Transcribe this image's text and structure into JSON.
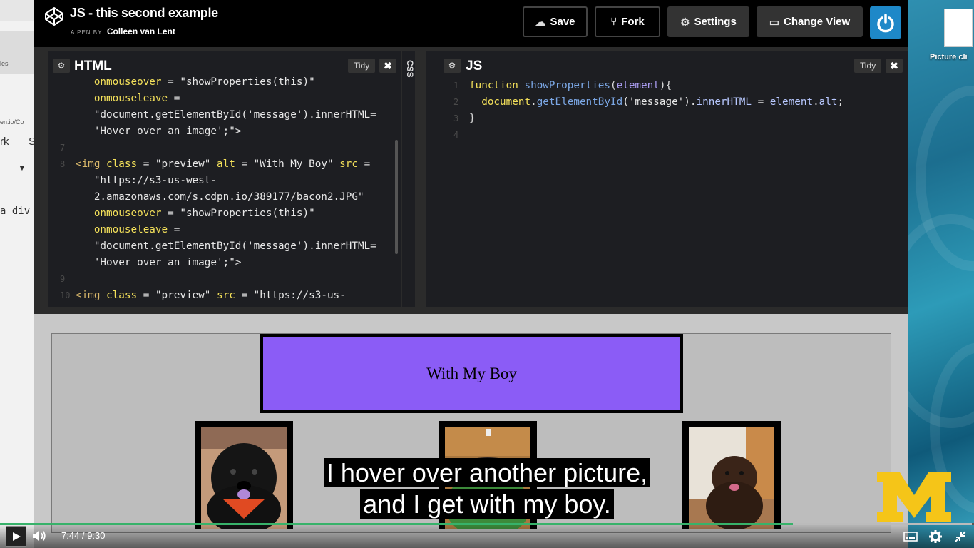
{
  "left_browser": {
    "fragments": [
      "les",
      "en.io/Co",
      "rk",
      "S",
      "▼",
      "a div"
    ]
  },
  "desktop": {
    "file_label": "Picture cli"
  },
  "header": {
    "logo_icon": "codepen-logo-icon",
    "title": "JS - this second example",
    "pen_by_tag": "A PEN BY",
    "author": "Colleen van Lent",
    "buttons": {
      "save": "Save",
      "fork": "Fork",
      "settings": "Settings",
      "change_view": "Change View"
    },
    "power_icon": "power-icon",
    "brand_color": "#1e88c8"
  },
  "html_pane": {
    "title": "HTML",
    "tidy": "Tidy",
    "close": "✖",
    "css_collapsed_label": "CSS",
    "lines": [
      {
        "n": "",
        "segments": [
          {
            "t": "   ",
            "c": ""
          },
          {
            "t": "onmouseover",
            "c": "attr"
          },
          {
            "t": " = ",
            "c": ""
          },
          {
            "t": "\"showProperties(this)\"",
            "c": "str"
          }
        ]
      },
      {
        "n": "",
        "segments": [
          {
            "t": "   ",
            "c": ""
          },
          {
            "t": "onmouseleave",
            "c": "attr"
          },
          {
            "t": " =",
            "c": ""
          }
        ]
      },
      {
        "n": "",
        "segments": [
          {
            "t": "   ",
            "c": ""
          },
          {
            "t": "\"document.getElementById('message').innerHTML=",
            "c": "str"
          }
        ]
      },
      {
        "n": "",
        "segments": [
          {
            "t": "   ",
            "c": ""
          },
          {
            "t": "'Hover over an image';\">",
            "c": "str"
          }
        ]
      },
      {
        "n": "7",
        "segments": []
      },
      {
        "n": "8",
        "segments": [
          {
            "t": "<img ",
            "c": "tag"
          },
          {
            "t": "class",
            "c": "attr"
          },
          {
            "t": " = ",
            "c": ""
          },
          {
            "t": "\"preview\"",
            "c": "str"
          },
          {
            "t": " ",
            "c": ""
          },
          {
            "t": "alt",
            "c": "attr"
          },
          {
            "t": " = ",
            "c": ""
          },
          {
            "t": "\"With My Boy\"",
            "c": "str"
          },
          {
            "t": " ",
            "c": ""
          },
          {
            "t": "src",
            "c": "attr"
          },
          {
            "t": " =",
            "c": ""
          }
        ]
      },
      {
        "n": "",
        "segments": [
          {
            "t": "   ",
            "c": ""
          },
          {
            "t": "\"https://s3-us-west-",
            "c": "str"
          }
        ]
      },
      {
        "n": "",
        "segments": [
          {
            "t": "   ",
            "c": ""
          },
          {
            "t": "2.amazonaws.com/s.cdpn.io/389177/bacon2.JPG\"",
            "c": "str"
          }
        ]
      },
      {
        "n": "",
        "segments": [
          {
            "t": "   ",
            "c": ""
          },
          {
            "t": "onmouseover",
            "c": "attr"
          },
          {
            "t": " = ",
            "c": ""
          },
          {
            "t": "\"showProperties(this)\"",
            "c": "str"
          }
        ]
      },
      {
        "n": "",
        "segments": [
          {
            "t": "   ",
            "c": ""
          },
          {
            "t": "onmouseleave",
            "c": "attr"
          },
          {
            "t": " =",
            "c": ""
          }
        ]
      },
      {
        "n": "",
        "segments": [
          {
            "t": "   ",
            "c": ""
          },
          {
            "t": "\"document.getElementById('message').innerHTML=",
            "c": "str"
          }
        ]
      },
      {
        "n": "",
        "segments": [
          {
            "t": "   ",
            "c": ""
          },
          {
            "t": "'Hover over an image';\">",
            "c": "str"
          }
        ]
      },
      {
        "n": "9",
        "segments": []
      },
      {
        "n": "10",
        "segments": [
          {
            "t": "<img ",
            "c": "tag"
          },
          {
            "t": "class",
            "c": "attr"
          },
          {
            "t": " = ",
            "c": ""
          },
          {
            "t": "\"preview\"",
            "c": "str"
          },
          {
            "t": " ",
            "c": ""
          },
          {
            "t": "src",
            "c": "attr"
          },
          {
            "t": " = ",
            "c": ""
          },
          {
            "t": "\"https://s3-us-",
            "c": "str"
          }
        ]
      }
    ]
  },
  "js_pane": {
    "title": "JS",
    "tidy": "Tidy",
    "close": "✖",
    "lines": [
      {
        "n": "1",
        "segments": [
          {
            "t": "function",
            "c": "kw"
          },
          {
            "t": " ",
            "c": ""
          },
          {
            "t": "showProperties",
            "c": "fn"
          },
          {
            "t": "(",
            "c": ""
          },
          {
            "t": "element",
            "c": "prm"
          },
          {
            "t": "){",
            "c": ""
          }
        ]
      },
      {
        "n": "2",
        "segments": [
          {
            "t": "  document",
            "c": "kw"
          },
          {
            "t": ".",
            "c": ""
          },
          {
            "t": "getElementById",
            "c": "fn"
          },
          {
            "t": "('message')",
            "c": "str"
          },
          {
            "t": ".",
            "c": ""
          },
          {
            "t": "innerHTML",
            "c": "prop"
          },
          {
            "t": " = ",
            "c": ""
          },
          {
            "t": "element",
            "c": "prop"
          },
          {
            "t": ".",
            "c": ""
          },
          {
            "t": "alt",
            "c": "prop"
          },
          {
            "t": ";",
            "c": ""
          }
        ]
      },
      {
        "n": "3",
        "segments": [
          {
            "t": "}",
            "c": ""
          }
        ]
      },
      {
        "n": "4",
        "segments": []
      }
    ]
  },
  "preview": {
    "message": "With My Boy",
    "message_color": "#8b5cf6",
    "thumbnails": [
      "dog-photo-1",
      "dog-photo-2",
      "dog-photo-3"
    ]
  },
  "video": {
    "current_time": "7:44",
    "separator": "/",
    "duration": "9:30",
    "progress_fraction": 0.814,
    "buffer_fraction": 0.998,
    "progress_color": "#37b26a",
    "subtitle_line1": "I hover over another picture,",
    "subtitle_line2": "and I get with my boy.",
    "icons": [
      "play-icon",
      "volume-icon",
      "captions-icon",
      "settings-icon",
      "exit-fullscreen-icon"
    ]
  },
  "watermark": {
    "label": "M",
    "color": "#f5c518"
  }
}
